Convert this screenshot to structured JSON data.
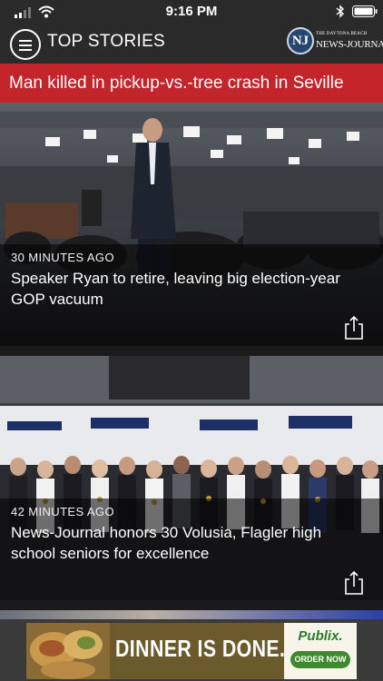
{
  "status_bar": {
    "time": "9:16 PM"
  },
  "app_bar": {
    "section_title": "TOP STORIES",
    "logo": {
      "monogram": "NJ",
      "line1": "THE DAYTONA BEACH",
      "line2": "NEWS-JOURNAL"
    }
  },
  "breaking": {
    "headline": "Man killed in pickup-vs.-tree crash in Seville"
  },
  "stories": [
    {
      "age": "30 MINUTES AGO",
      "headline": "Speaker Ryan to retire, leaving big election-year GOP vacuum",
      "icon": "share-icon"
    },
    {
      "age": "42 MINUTES AGO",
      "headline": "News-Journal honors 30 Volusia, Flagler high school seniors for excellence",
      "icon": "share-icon"
    }
  ],
  "ad": {
    "tagline": "DINNER IS DONE.",
    "brand": "Publix.",
    "cta": "ORDER NOW"
  },
  "colors": {
    "breaking_bg": "#c4252b",
    "bar_bg": "#2a2a2a",
    "ad_cta": "#3e8a2e"
  }
}
